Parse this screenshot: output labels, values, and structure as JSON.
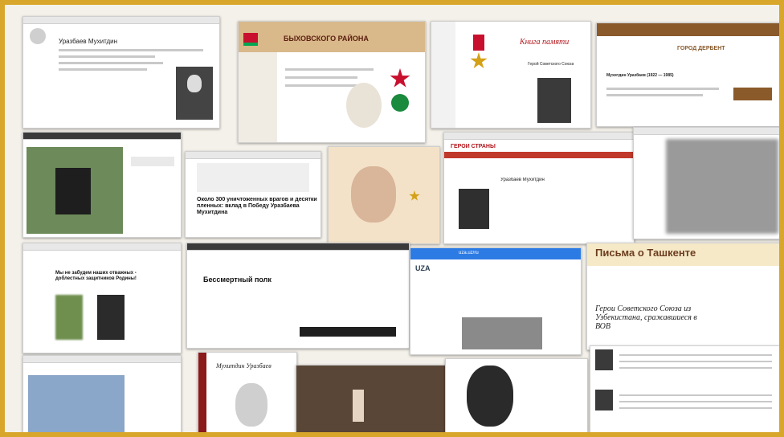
{
  "screenshots": {
    "s1": {
      "heading": "Уразбаев Мухитдин"
    },
    "s2": {
      "banner": "БЫХОВСКОГО РАЙОНА"
    },
    "s3": {
      "title": "Книга памяти",
      "caption": "Герой Советского Союза"
    },
    "s4": {
      "logo": "ГОРОД ДЕРБЕНТ",
      "heading": "Мухитдин Уразбаев (1922 — 1985)"
    },
    "s9": {
      "heading": "Около 300 уничтоженных врагов и десятки пленных: вклад в Победу Уразбаева Мухитдина"
    },
    "s11": {
      "logo": "ГЕРОИ СТРАНЫ",
      "heading": "Уразбаев Мухитдин"
    },
    "s13": {
      "heading": "Мы не забудем наших отважных - доблестных защитников Родины!"
    },
    "s14": {
      "heading": "Бессмертный полк"
    },
    "s15": {
      "brand": "UZA",
      "url": "uza.uz/ru"
    },
    "s16": {
      "title": "Письма о Ташкенте",
      "subtitle": "Герои Советского Союза из Узбекистана, сражавшиеся в ВОВ"
    },
    "s18": {
      "name": "Мухитдин Уразбаев"
    }
  },
  "colors": {
    "frame": "#d8a62b",
    "wiki_bg": "#ffffff",
    "red": "#b3131a"
  }
}
